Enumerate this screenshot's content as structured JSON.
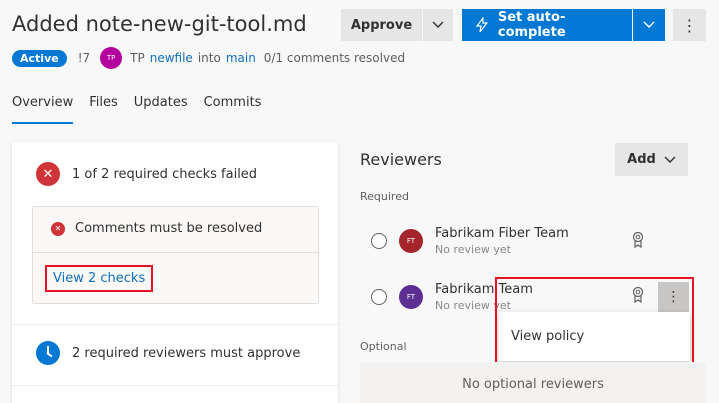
{
  "header": {
    "title": "Added note-new-git-tool.md",
    "approve_label": "Approve",
    "auto_complete_label": "Set auto-complete",
    "more_label": "⋮"
  },
  "meta": {
    "status": "Active",
    "pr_id": "!7",
    "author_initials": "TP",
    "author": "TP",
    "source_branch": "newfile",
    "into_text": "into",
    "target_branch": "main",
    "comments_resolved": "0/1 comments resolved"
  },
  "tabs": [
    {
      "label": "Overview"
    },
    {
      "label": "Files"
    },
    {
      "label": "Updates"
    },
    {
      "label": "Commits"
    }
  ],
  "checks": {
    "summary": "1 of 2 required checks failed",
    "comments_check": "Comments must be resolved",
    "view_checks_link": "View 2 checks",
    "reviewers_required": "2 required reviewers must approve"
  },
  "reviewers": {
    "title": "Reviewers",
    "add_label": "Add",
    "required_label": "Required",
    "optional_label": "Optional",
    "no_optional": "No optional reviewers",
    "required": [
      {
        "initials": "FT",
        "name": "Fabrikam Fiber Team",
        "status": "No review yet",
        "avatar_color": "#a4262c"
      },
      {
        "initials": "FT",
        "name": "Fabrikam Team",
        "status": "No review yet",
        "avatar_color": "#5c2e91"
      }
    ],
    "context_menu": {
      "view_policy": "View policy"
    }
  },
  "colors": {
    "accent": "#0078d4",
    "error": "#d13438",
    "highlight": "#e81123"
  }
}
